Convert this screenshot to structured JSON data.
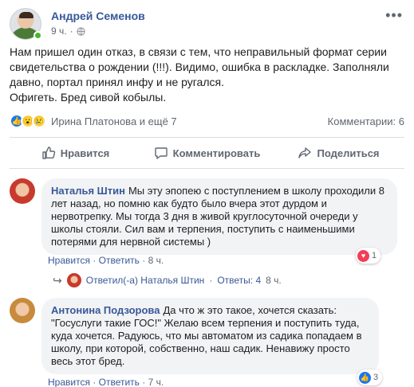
{
  "post": {
    "author": "Андрей Семенов",
    "time": "9 ч.",
    "paragraphs": [
      "Нам пришел один отказ, в связи с тем, что неправильный формат серии свидетельства о рождении (!!!). Видимо, ошибка в раскладке. Заполняли давно, портал принял инфу и не ругался.",
      "Офигеть. Бред сивой кобылы."
    ]
  },
  "reactions": {
    "icons": [
      "like-icon",
      "wow-icon",
      "sad-icon"
    ],
    "reactors": "Ирина Платонова и ещё 7",
    "comments": "Комментарии: 6"
  },
  "actions": {
    "like": "Нравится",
    "comment": "Комментировать",
    "share": "Поделиться"
  },
  "comments": [
    {
      "author": "Наталья Штин",
      "text": "Мы эту эпопею с поступлением в школу проходили 8 лет назад, но помню как будто было вчера этот дурдом и нервотрепку. Мы тогда 3 дня в живой круглосуточной очереди у школы стояли. Сил вам и терпения, поступить с наименьшими потерями для нервной системы )",
      "like": "Нравится",
      "reply": "Ответить",
      "time": "8 ч.",
      "reaction_count": "1",
      "reply_summary": {
        "label": "Ответил(-а) Наталья Штин",
        "count": "Ответы: 4",
        "time": "8 ч."
      }
    },
    {
      "author": "Антонина Подзорова",
      "text": "Да что ж это такое, хочется сказать: \"Госуслуги такие ГОС!\" Желаю всем терпения и поступить туда, куда хочется. Радуюсь, что мы автоматом из садика попадаем в школу, при которой, собственно, наш садик. Ненавижу просто весь этот бред.",
      "like": "Нравится",
      "reply": "Ответить",
      "time": "7 ч.",
      "reaction_count": "3"
    }
  ],
  "colors": {
    "link": "#385898",
    "meta": "#606770",
    "bubble": "#f2f3f5",
    "online": "#42b72a",
    "like": "#1877f2",
    "heart": "#f33e58"
  }
}
